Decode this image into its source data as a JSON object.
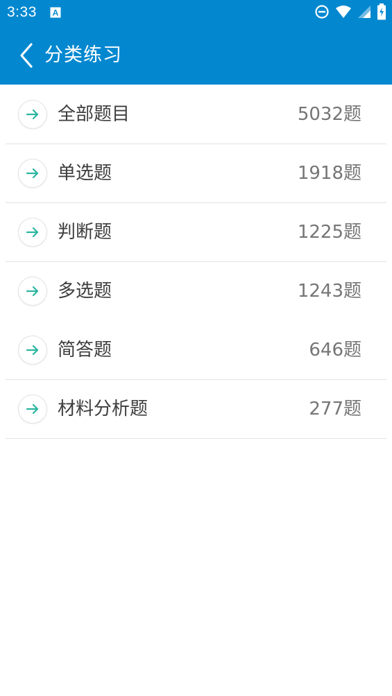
{
  "status_bar": {
    "time": "3:33",
    "icons": [
      "notification-a-icon",
      "do-not-disturb-icon",
      "wifi-icon",
      "cell-signal-icon",
      "battery-charging-icon"
    ]
  },
  "app_bar": {
    "back_icon": "chevron-left-icon",
    "title": "分类练习"
  },
  "categories": [
    {
      "label": "全部题目",
      "count": "5032题",
      "icon": "arrow-right-icon"
    },
    {
      "label": "单选题",
      "count": "1918题",
      "icon": "arrow-right-icon"
    },
    {
      "label": "判断题",
      "count": "1225题",
      "icon": "arrow-right-icon"
    },
    {
      "label": "多选题",
      "count": "1243题",
      "icon": "arrow-right-icon"
    },
    {
      "label": "简答题",
      "count": "646题",
      "icon": "arrow-right-icon"
    },
    {
      "label": "材料分析题",
      "count": "277题",
      "icon": "arrow-right-icon"
    }
  ],
  "colors": {
    "primary": "#0388d0",
    "arrow_accent": "#2bb5a0",
    "label_text": "#3d3d3d",
    "count_text": "#757575"
  }
}
